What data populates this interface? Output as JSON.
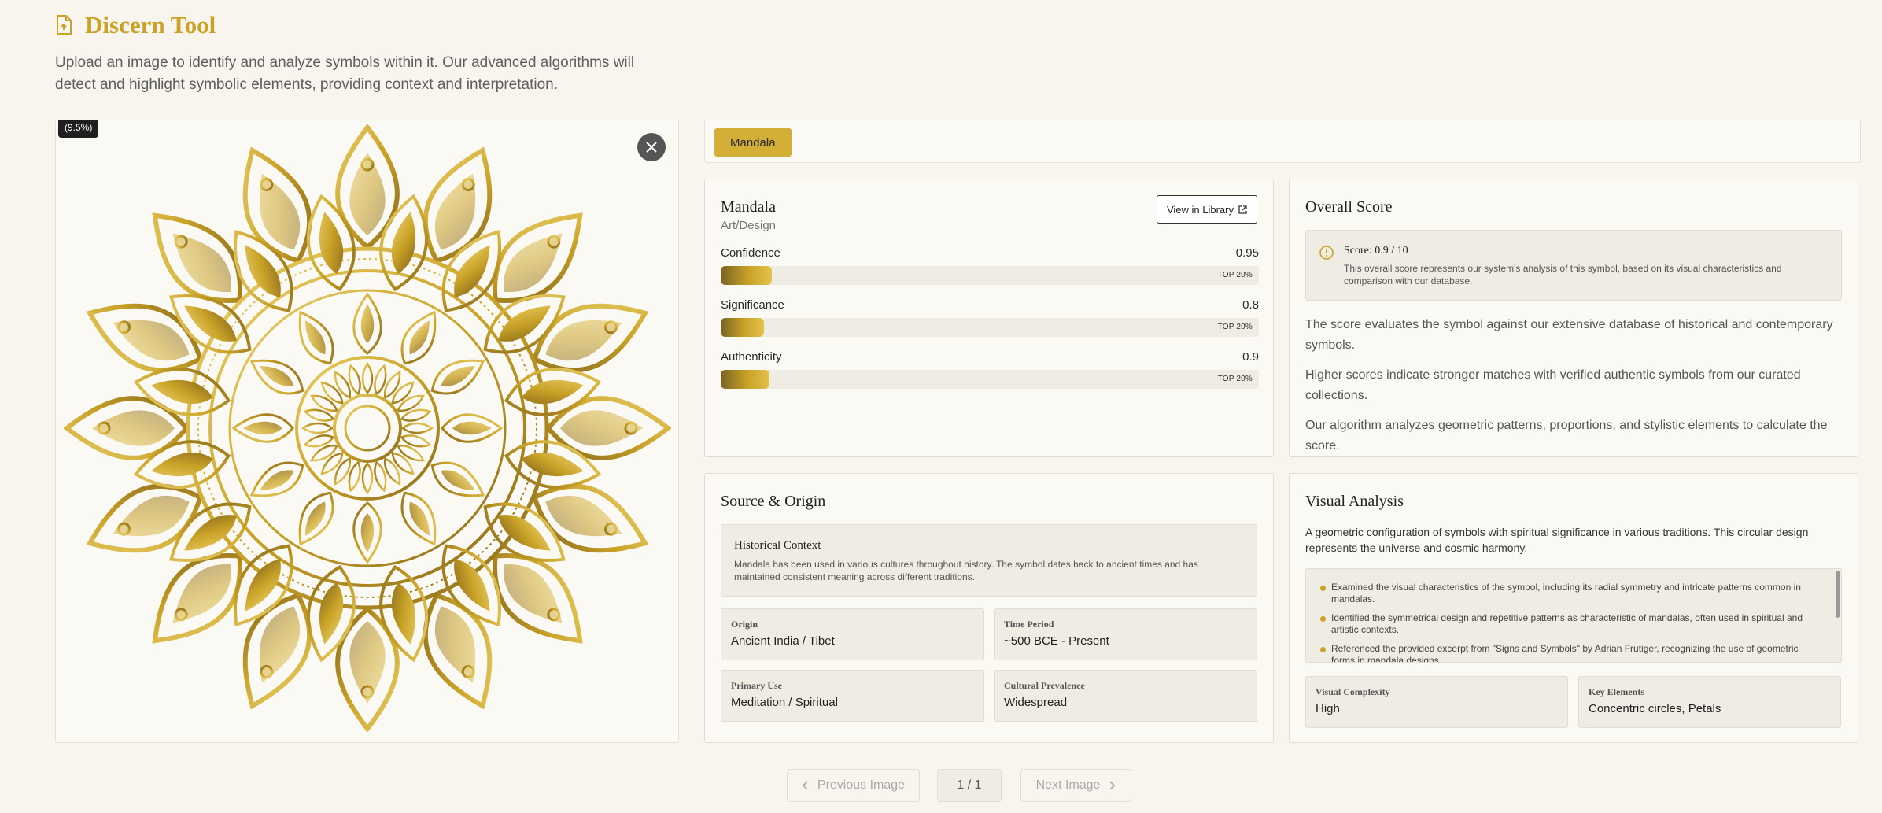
{
  "header": {
    "title": "Discern Tool",
    "description": "Upload an image to identify and analyze symbols within it. Our advanced algorithms will detect and highlight symbolic elements, providing context and interpretation."
  },
  "image_panel": {
    "percent_badge": "(9.5%)"
  },
  "tags": [
    "Mandala"
  ],
  "symbol": {
    "name": "Mandala",
    "category": "Art/Design",
    "library_button": "View in Library",
    "metrics": [
      {
        "label": "Confidence",
        "value": "0.95",
        "fill": 0.095,
        "rank": "TOP 20%"
      },
      {
        "label": "Significance",
        "value": "0.8",
        "fill": 0.08,
        "rank": "TOP 20%"
      },
      {
        "label": "Authenticity",
        "value": "0.9",
        "fill": 0.09,
        "rank": "TOP 20%"
      }
    ]
  },
  "score": {
    "title": "Overall Score",
    "label": "Score: 0.9 / 10",
    "note": "This overall score represents our system's analysis of this symbol, based on its visual characteristics and comparison with our database.",
    "paragraphs": [
      "The score evaluates the symbol against our extensive database of historical and contemporary symbols.",
      "Higher scores indicate stronger matches with verified authentic symbols from our curated collections.",
      "Our algorithm analyzes geometric patterns, proportions, and stylistic elements to calculate the score."
    ]
  },
  "source": {
    "title": "Source & Origin",
    "history_title": "Historical Context",
    "history_text": "Mandala has been used in various cultures throughout history. The symbol dates back to ancient times and has maintained consistent meaning across different traditions.",
    "fields": [
      {
        "label": "Origin",
        "value": "Ancient India / Tibet"
      },
      {
        "label": "Time Period",
        "value": "~500 BCE - Present"
      },
      {
        "label": "Primary Use",
        "value": "Meditation / Spiritual"
      },
      {
        "label": "Cultural Prevalence",
        "value": "Widespread"
      }
    ]
  },
  "visual": {
    "title": "Visual Analysis",
    "description": "A geometric configuration of symbols with spiritual significance in various traditions. This circular design represents the universe and cosmic harmony.",
    "steps": [
      "Examined the visual characteristics of the symbol, including its radial symmetry and intricate patterns common in mandalas.",
      "Identified the symmetrical design and repetitive patterns as characteristic of mandalas, often used in spiritual and artistic contexts.",
      "Referenced the provided excerpt from \"Signs and Symbols\" by Adrian Frutiger, recognizing the use of geometric forms in mandala designs."
    ],
    "fields": [
      {
        "label": "Visual Complexity",
        "value": "High"
      },
      {
        "label": "Key Elements",
        "value": "Concentric circles, Petals"
      }
    ]
  },
  "pagination": {
    "previous": "Previous Image",
    "counter": "1 / 1",
    "next": "Next Image"
  },
  "colors": {
    "accent": "#c9a227",
    "tag": "#d4af37",
    "background": "#f8f5ef"
  }
}
